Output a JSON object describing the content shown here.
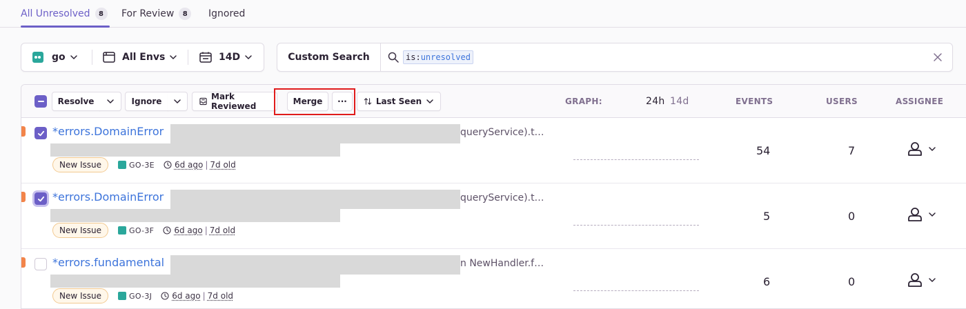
{
  "tabs": [
    {
      "label": "All Unresolved",
      "count": "8",
      "active": true
    },
    {
      "label": "For Review",
      "count": "8",
      "active": false
    },
    {
      "label": "Ignored",
      "count": "",
      "active": false
    }
  ],
  "filters": {
    "project": "go",
    "environment": "All Envs",
    "period": "14D"
  },
  "search": {
    "custom_label": "Custom Search",
    "token_key": "is:",
    "token_value": "unresolved"
  },
  "toolbar": {
    "resolve_label": "Resolve",
    "ignore_label": "Ignore",
    "mark_reviewed_label": "Mark Reviewed",
    "merge_label": "Merge",
    "more_label": "···",
    "sort_label": "Last Seen"
  },
  "columns": {
    "graph": "GRAPH:",
    "period_24h": "24h",
    "period_14d": "14d",
    "events": "EVENTS",
    "users": "USERS",
    "assignee": "ASSIGNEE"
  },
  "issues": [
    {
      "title": "*errors.DomainError",
      "culprit": "queryService).t…",
      "status": "New Issue",
      "short_id": "GO-3E",
      "last_seen": "6d ago",
      "first_seen": "7d old",
      "events": "54",
      "users": "7",
      "checked": true
    },
    {
      "title": "*errors.DomainError",
      "culprit": "queryService).t…",
      "status": "New Issue",
      "short_id": "GO-3F",
      "last_seen": "6d ago",
      "first_seen": "7d old",
      "events": "5",
      "users": "0",
      "checked": true
    },
    {
      "title": "*errors.fundamental",
      "culprit": "n NewHandler.f…",
      "status": "New Issue",
      "short_id": "GO-3J",
      "last_seen": "6d ago",
      "first_seen": "7d old",
      "events": "6",
      "users": "0",
      "checked": false
    }
  ],
  "colors": {
    "accent": "#6c5fc7",
    "link": "#3d74db",
    "level_warning": "#f2844a",
    "project_icon": "#2aa79b",
    "highlight": "#e01b1b"
  }
}
